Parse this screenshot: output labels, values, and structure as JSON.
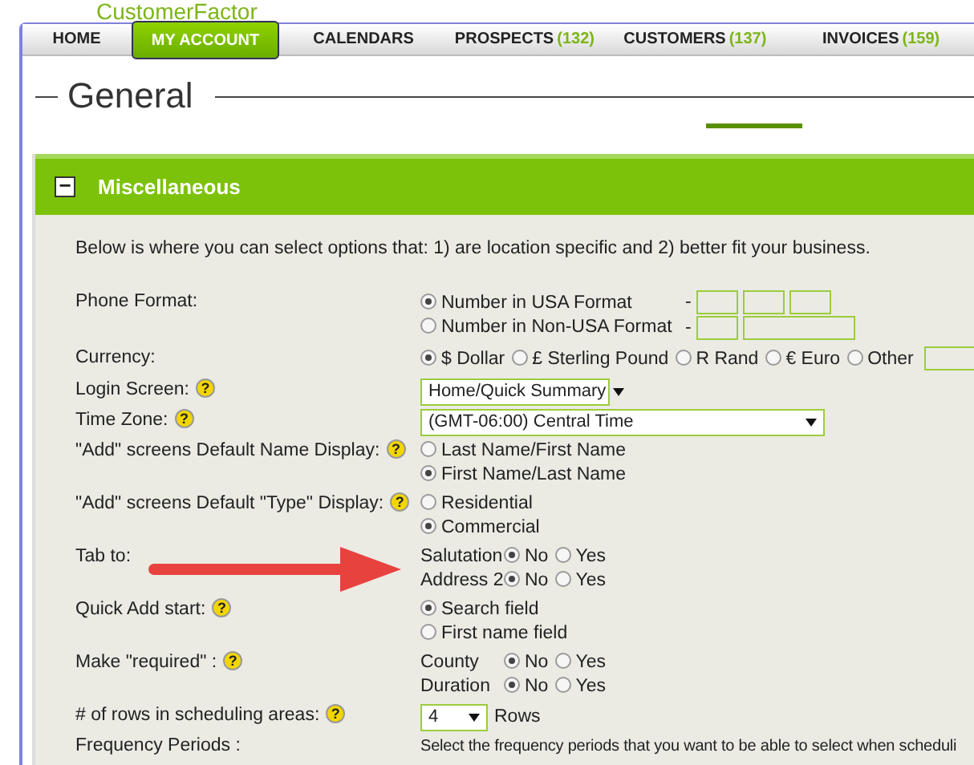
{
  "logo": "CustomerFactor",
  "tabs": [
    {
      "label": "HOME",
      "selected": false
    },
    {
      "label": "MY ACCOUNT",
      "selected": true
    },
    {
      "label": "CALENDARS",
      "selected": false
    },
    {
      "label": "PROSPECTS",
      "count": "(132)",
      "selected": false
    },
    {
      "label": "CUSTOMERS",
      "count": "(137)",
      "selected": false
    },
    {
      "label": "INVOICES",
      "count": "(159)",
      "selected": false
    }
  ],
  "page_title": "General",
  "section": {
    "title": "Miscellaneous",
    "expanded": true,
    "toggle": "−"
  },
  "intro": "Below is where you can select options that: 1) are location specific and 2) better fit your business.",
  "fields": [
    {
      "kind": "phone",
      "label": "Phone Format:",
      "options": [
        {
          "label": "Number in USA Format",
          "selected": true,
          "separator": "-"
        },
        {
          "label": "Number in Non-USA Format",
          "selected": false,
          "separator": "-"
        }
      ]
    },
    {
      "kind": "inline_radios",
      "label": "Currency:",
      "options": [
        {
          "label": "$ Dollar",
          "selected": true
        },
        {
          "label": "£ Sterling Pound",
          "selected": false
        },
        {
          "label": "R Rand",
          "selected": false
        },
        {
          "label": "€ Euro",
          "selected": false
        },
        {
          "label": "Other",
          "selected": false,
          "has_input": true
        }
      ]
    },
    {
      "kind": "select",
      "label": "Login Screen:",
      "help": "?",
      "value": "Home/Quick Summary"
    },
    {
      "kind": "select_wide",
      "label": "Time Zone:",
      "help": "?",
      "value": "(GMT-06:00) Central Time"
    },
    {
      "kind": "radios",
      "label": "\"Add\" screens Default Name Display:",
      "help": "?",
      "options": [
        {
          "label": "Last Name/First Name",
          "selected": false
        },
        {
          "label": "First Name/Last Name",
          "selected": true
        }
      ]
    },
    {
      "kind": "radios",
      "label": "\"Add\" screens Default \"Type\" Display:",
      "help": "?",
      "options": [
        {
          "label": "Residential",
          "selected": false
        },
        {
          "label": "Commercial",
          "selected": true
        }
      ]
    },
    {
      "kind": "yes_no",
      "label": "Tab to:",
      "rows": [
        {
          "label": "Salutation",
          "options": [
            {
              "label": "No",
              "selected": true
            },
            {
              "label": "Yes",
              "selected": false
            }
          ]
        },
        {
          "label": "Address 2",
          "options": [
            {
              "label": "No",
              "selected": true
            },
            {
              "label": "Yes",
              "selected": false
            }
          ]
        }
      ]
    },
    {
      "kind": "radios",
      "label": "Quick Add start:",
      "help": "?",
      "options": [
        {
          "label": "Search field",
          "selected": true
        },
        {
          "label": "First name field",
          "selected": false
        }
      ]
    },
    {
      "kind": "yes_no",
      "label": "Make \"required\" :",
      "help": "?",
      "rows": [
        {
          "label": "County",
          "options": [
            {
              "label": "No",
              "selected": true
            },
            {
              "label": "Yes",
              "selected": false
            }
          ]
        },
        {
          "label": "Duration",
          "options": [
            {
              "label": "No",
              "selected": true
            },
            {
              "label": "Yes",
              "selected": false
            }
          ]
        }
      ]
    },
    {
      "kind": "select",
      "label": "# of rows in scheduling areas:",
      "help": "?",
      "value": "4",
      "suffix": "Rows"
    },
    {
      "kind": "text",
      "label": "Frequency Periods :",
      "value": "Select the frequency periods that you want to be able to select when scheduli"
    }
  ]
}
